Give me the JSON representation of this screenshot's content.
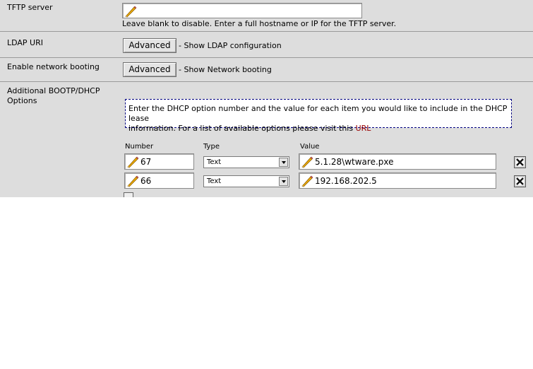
{
  "tftp": {
    "label": "TFTP server",
    "value": "",
    "help": "Leave blank to disable. Enter a full hostname or IP for the TFTP server."
  },
  "ldap": {
    "label": "LDAP URI",
    "button_label": "Advanced",
    "caption": "- Show LDAP configuration"
  },
  "netboot": {
    "label": "Enable network booting",
    "button_label": "Advanced",
    "caption": "- Show Network booting"
  },
  "dhcp_options": {
    "label_line1": "Additional BOOTP/DHCP",
    "label_line2": "Options",
    "info_line1": "Enter the DHCP option number and the value for each item you would like to include in the DHCP lease",
    "info_line2_prefix": "information. For a list of available options please visit this ",
    "info_link": "URL",
    "headers": {
      "number": "Number",
      "type": "Type",
      "value": "Value"
    },
    "rows": [
      {
        "number": "67",
        "type": "Text",
        "value": "5.1.28\\wtware.pxe"
      },
      {
        "number": "66",
        "type": "Text",
        "value": "192.168.202.5"
      }
    ]
  },
  "icons": {
    "edit": "pencil-icon",
    "delete": "delete-row-icon",
    "add": "add-row-icon"
  }
}
